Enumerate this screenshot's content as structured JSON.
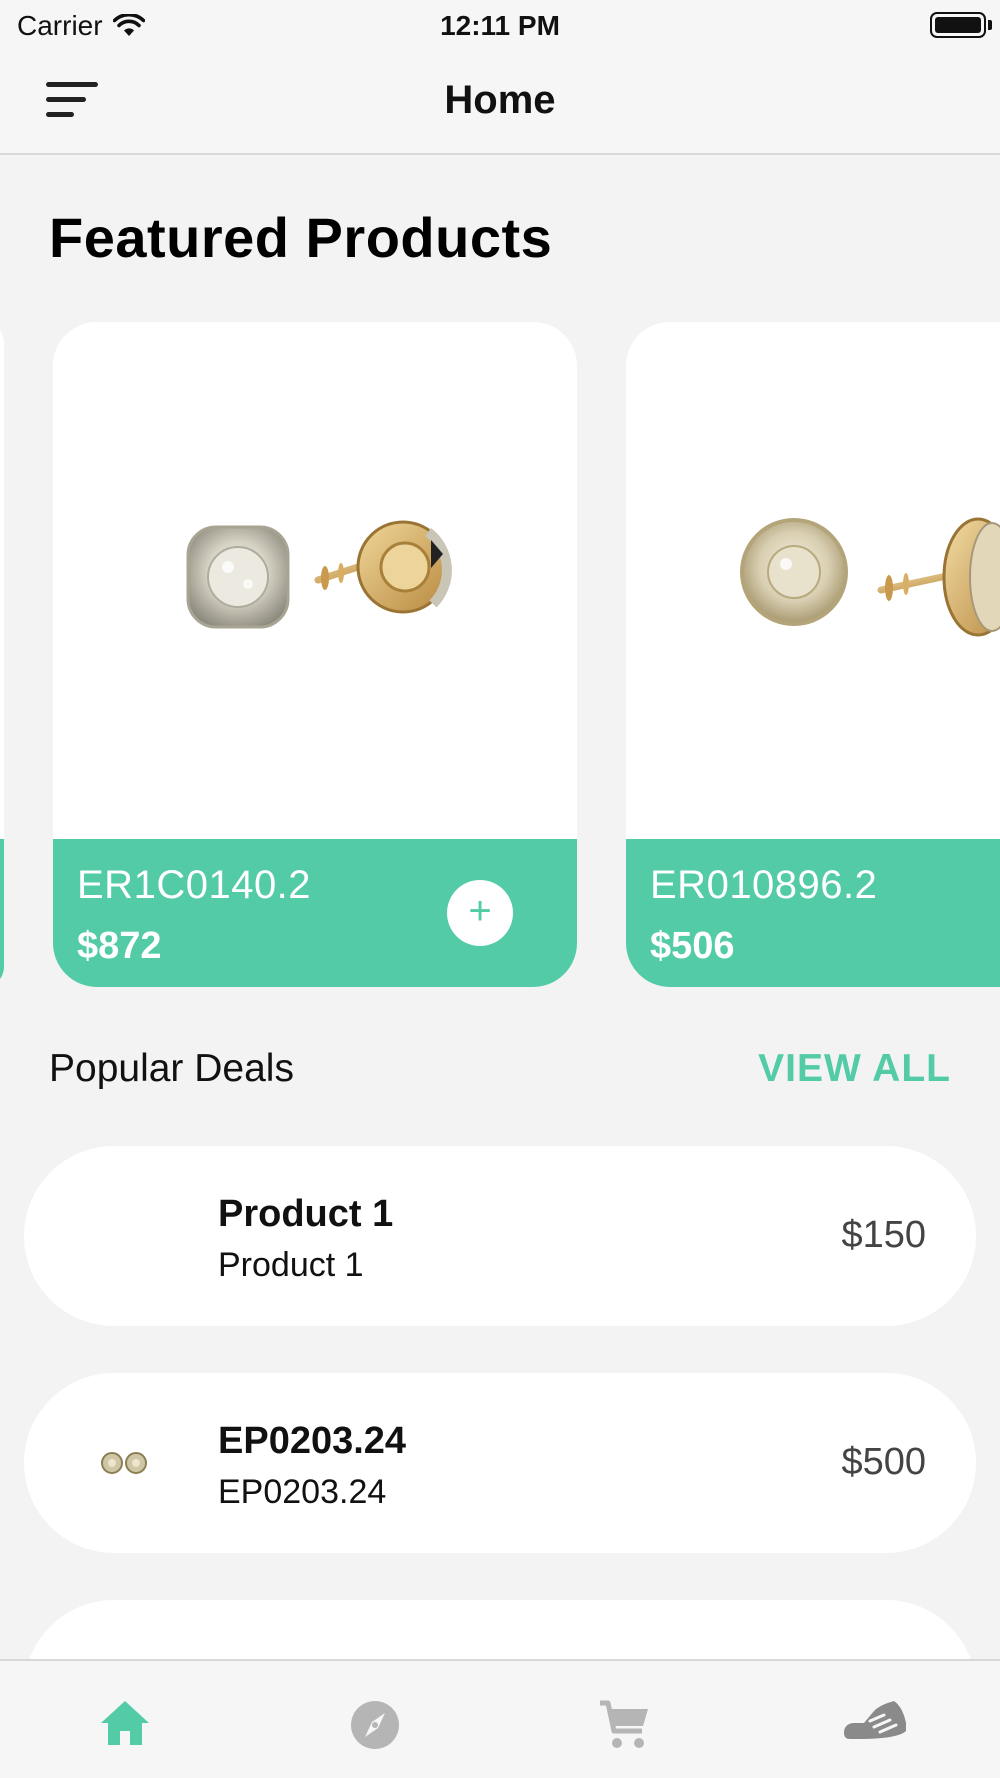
{
  "status_bar": {
    "carrier": "Carrier",
    "time": "12:11 PM"
  },
  "nav": {
    "title": "Home",
    "menu_icon": "menu-icon"
  },
  "featured": {
    "title": "Featured Products",
    "products": [
      {
        "sku": "ER1C0140.2",
        "price": "$872",
        "add_label": "+"
      },
      {
        "sku": "ER010896.2",
        "price": "$506",
        "add_label": "+"
      }
    ]
  },
  "popular": {
    "title": "Popular Deals",
    "view_all": "VIEW ALL",
    "deals": [
      {
        "name": "Product 1",
        "subtitle": "Product 1",
        "price": "$150"
      },
      {
        "name": "EP0203.24",
        "subtitle": "EP0203.24",
        "price": "$500"
      }
    ]
  },
  "tabs": [
    {
      "icon": "home-icon",
      "active": true
    },
    {
      "icon": "compass-icon",
      "active": false
    },
    {
      "icon": "cart-icon",
      "active": false
    },
    {
      "icon": "sneaker-icon",
      "active": false
    }
  ],
  "colors": {
    "accent": "#52cba6",
    "background": "#f3f3f3",
    "inactive_icon": "#b5b5b5",
    "shoe_icon": "#8a8a8a"
  }
}
